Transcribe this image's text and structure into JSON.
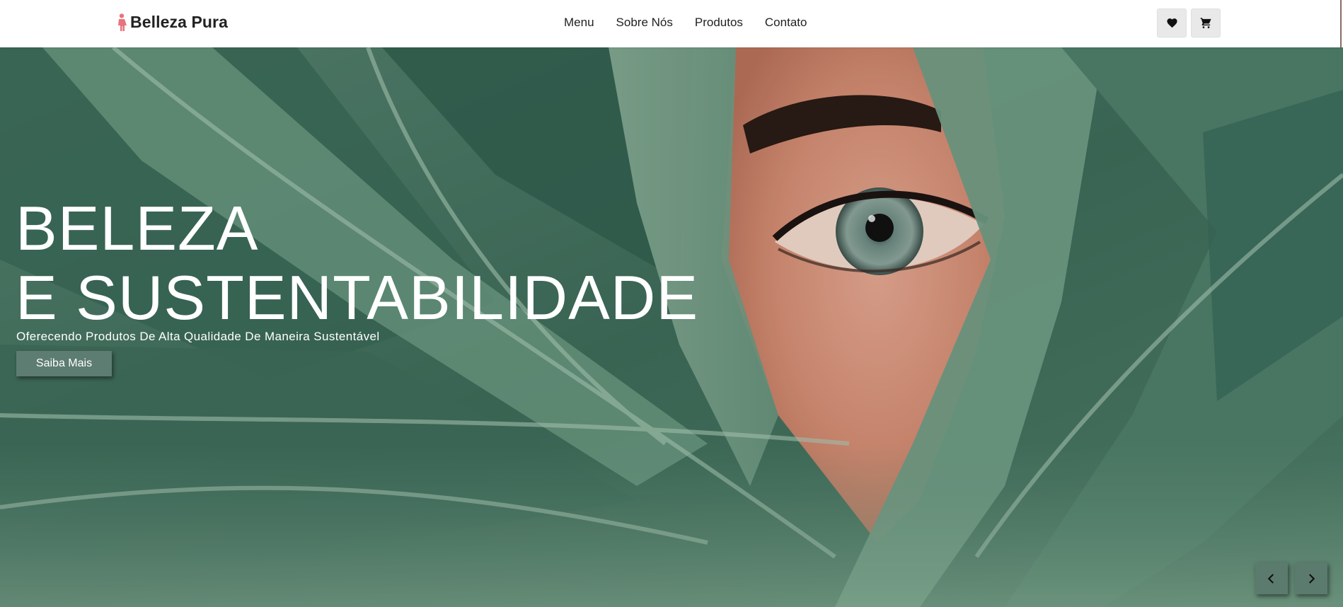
{
  "header": {
    "brand_name": "Belleza Pura",
    "brand_icon": "woman-figure-icon",
    "brand_color": "#e8747c",
    "nav": [
      {
        "label": "Menu"
      },
      {
        "label": "Sobre Nós"
      },
      {
        "label": "Produtos"
      },
      {
        "label": "Contato"
      }
    ],
    "actions": [
      {
        "icon": "heart-icon"
      },
      {
        "icon": "cart-icon"
      }
    ]
  },
  "hero": {
    "title_line1": "BELEZA",
    "title_line2": "E SUSTENTABILIDADE",
    "subtitle": "Oferecendo Produtos De Alta Qualidade De Maneira Sustentável",
    "cta_label": "Saiba Mais",
    "background": "photo-eye-behind-green-leaves",
    "carousel": {
      "prev_icon": "chevron-left-icon",
      "next_icon": "chevron-right-icon"
    }
  },
  "colors": {
    "text_dark": "#222222",
    "hero_text": "#ffffff",
    "button_bg": "#5e7d72",
    "icon_button_bg": "#e9e9e9"
  }
}
